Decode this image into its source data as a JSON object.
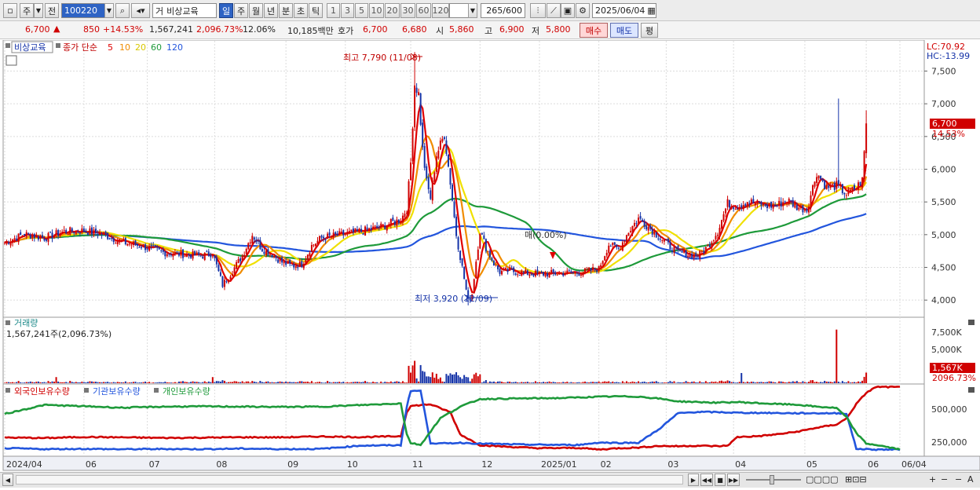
{
  "toolbar": {
    "item_tab": "주",
    "prev_label": "전",
    "code": "100220",
    "name": "비상교육",
    "periods": [
      "일",
      "주",
      "월",
      "년",
      "분",
      "초",
      "틱"
    ],
    "active_period": "일",
    "intervals": [
      "1",
      "3",
      "5",
      "10",
      "20",
      "30",
      "60",
      "120"
    ],
    "count": "265",
    "count_total": "/600",
    "date": "2025/06/04"
  },
  "quote": {
    "price": "6,700",
    "change": "850",
    "change_pct": "+14.53%",
    "volume": "1,567,241",
    "volume_ratio": "2,096.73%",
    "turnover": "12.06%",
    "amount": "10,185백만",
    "bid_label": "호가",
    "bid1": "6,700",
    "bid2": "6,680",
    "open_label": "시",
    "open": "5,860",
    "high_label": "고",
    "high": "6,900",
    "low_label": "저",
    "low": "5,800",
    "buy": "매수",
    "sell": "매도",
    "eval": "평"
  },
  "colors": {
    "up": "#d00000",
    "down": "#1533a8",
    "ma5": "#e00000",
    "ma10": "#f08c00",
    "ma20": "#f0e000",
    "ma60": "#1e9a3a",
    "ma120": "#2255dd"
  },
  "price_panel": {
    "item_name": "비상교육",
    "ma_title": "종가 단순",
    "ma_periods": [
      "5",
      "10",
      "20",
      "60",
      "120"
    ],
    "lc": "LC:70.92",
    "hc": "HC:-13.99",
    "annot_high": "최고 7,790 (11/08)",
    "annot_low": "최저 3,920 (12/09)",
    "annot_mid": "매(0.00%)",
    "last_price": "6,700",
    "last_pct": "14.53%"
  },
  "volume_panel": {
    "title": "거래량",
    "value": "1,567,241주(2,096.73%)",
    "last": "1,567K",
    "last_pct": "2096.73%"
  },
  "holding_panel": {
    "foreign": "외국인보유수량",
    "inst": "기관보유수량",
    "indiv": "개인보유수량"
  },
  "x_axis_labels": [
    {
      "t": "2024/04",
      "i": 0
    },
    {
      "t": "06",
      "i": 40
    },
    {
      "t": "07",
      "i": 72
    },
    {
      "t": "08",
      "i": 106
    },
    {
      "t": "09",
      "i": 142
    },
    {
      "t": "10",
      "i": 172
    },
    {
      "t": "11",
      "i": 205
    },
    {
      "t": "12",
      "i": 240
    },
    {
      "t": "2025/01",
      "i": 270
    },
    {
      "t": "02",
      "i": 300
    },
    {
      "t": "03",
      "i": 334
    },
    {
      "t": "04",
      "i": 368
    },
    {
      "t": "05",
      "i": 404
    },
    {
      "t": "06",
      "i": 435
    },
    {
      "t": "06/04",
      "i": 452
    }
  ],
  "chart_data": [
    {
      "type": "candlestick",
      "title": "비상교육",
      "y_ticks": [
        "7,500",
        "7,000",
        "6,500",
        "6,000",
        "5,500",
        "5,000",
        "4,500",
        "4,000"
      ],
      "ylim": [
        3750,
        7950
      ],
      "anchors_close": [
        [
          0,
          4880
        ],
        [
          10,
          5010
        ],
        [
          20,
          4950
        ],
        [
          30,
          5050
        ],
        [
          40,
          5060
        ],
        [
          50,
          5000
        ],
        [
          60,
          4880
        ],
        [
          70,
          4820
        ],
        [
          80,
          4730
        ],
        [
          90,
          4700
        ],
        [
          100,
          4680
        ],
        [
          105,
          4720
        ],
        [
          110,
          4230
        ],
        [
          115,
          4450
        ],
        [
          120,
          4680
        ],
        [
          125,
          5000
        ],
        [
          130,
          4780
        ],
        [
          135,
          4700
        ],
        [
          140,
          4580
        ],
        [
          145,
          4520
        ],
        [
          150,
          4550
        ],
        [
          155,
          4830
        ],
        [
          160,
          4950
        ],
        [
          170,
          5000
        ],
        [
          180,
          5050
        ],
        [
          190,
          5120
        ],
        [
          200,
          5230
        ],
        [
          203,
          5400
        ],
        [
          205,
          6100
        ],
        [
          207,
          7300
        ],
        [
          209,
          7150
        ],
        [
          211,
          6300
        ],
        [
          213,
          5800
        ],
        [
          215,
          5560
        ],
        [
          218,
          6220
        ],
        [
          222,
          6530
        ],
        [
          225,
          5800
        ],
        [
          228,
          5000
        ],
        [
          232,
          4330
        ],
        [
          234,
          3980
        ],
        [
          236,
          4100
        ],
        [
          238,
          4600
        ],
        [
          240,
          5060
        ],
        [
          243,
          4800
        ],
        [
          247,
          4560
        ],
        [
          250,
          4430
        ],
        [
          255,
          4450
        ],
        [
          260,
          4420
        ],
        [
          270,
          4400
        ],
        [
          280,
          4410
        ],
        [
          290,
          4420
        ],
        [
          300,
          4480
        ],
        [
          305,
          4850
        ],
        [
          310,
          4780
        ],
        [
          315,
          5050
        ],
        [
          320,
          5250
        ],
        [
          325,
          5120
        ],
        [
          330,
          4980
        ],
        [
          335,
          4840
        ],
        [
          340,
          4730
        ],
        [
          345,
          4700
        ],
        [
          350,
          4680
        ],
        [
          355,
          4820
        ],
        [
          360,
          5050
        ],
        [
          365,
          5480
        ],
        [
          370,
          5430
        ],
        [
          375,
          5510
        ],
        [
          380,
          5470
        ],
        [
          385,
          5440
        ],
        [
          390,
          5450
        ],
        [
          395,
          5530
        ],
        [
          400,
          5430
        ],
        [
          405,
          5380
        ],
        [
          410,
          5950
        ],
        [
          415,
          5720
        ],
        [
          420,
          5750
        ],
        [
          425,
          5620
        ],
        [
          430,
          5720
        ],
        [
          433,
          5830
        ],
        [
          435,
          6700
        ]
      ],
      "x_label_count": 436
    },
    {
      "type": "bar",
      "title": "거래량",
      "y_ticks": [
        "7,500K",
        "5,000K",
        "2,500K"
      ],
      "ylim": [
        0,
        9600
      ]
    },
    {
      "type": "line",
      "title": "보유수량",
      "y_ticks": [
        "500,000",
        "250,000"
      ],
      "ylim": [
        150000,
        680000
      ],
      "series": [
        {
          "name": "외국인보유수량",
          "anchors": [
            [
              0,
              286000
            ],
            [
              20,
              282000
            ],
            [
              40,
              290000
            ],
            [
              60,
              287000
            ],
            [
              80,
              283000
            ],
            [
              100,
              285000
            ],
            [
              120,
              288000
            ],
            [
              140,
              287000
            ],
            [
              160,
              294000
            ],
            [
              180,
              289000
            ],
            [
              200,
              296000
            ],
            [
              203,
              480000
            ],
            [
              205,
              525000
            ],
            [
              215,
              538000
            ],
            [
              225,
              478000
            ],
            [
              230,
              310000
            ],
            [
              235,
              268000
            ],
            [
              240,
              228000
            ],
            [
              255,
              215000
            ],
            [
              270,
              205000
            ],
            [
              290,
              207000
            ],
            [
              300,
              195000
            ],
            [
              310,
              205000
            ],
            [
              320,
              210000
            ],
            [
              330,
              222000
            ],
            [
              340,
              220000
            ],
            [
              350,
              224000
            ],
            [
              360,
              220000
            ],
            [
              365,
              225000
            ],
            [
              370,
              290000
            ],
            [
              380,
              296000
            ],
            [
              390,
              310000
            ],
            [
              400,
              330000
            ],
            [
              410,
              360000
            ],
            [
              420,
              385000
            ],
            [
              425,
              430000
            ],
            [
              430,
              540000
            ],
            [
              435,
              625000
            ],
            [
              440,
              670000
            ],
            [
              452,
              668000
            ]
          ]
        },
        {
          "name": "기관보유수량",
          "anchors": [
            [
              0,
              205000
            ],
            [
              20,
              198000
            ],
            [
              40,
              200000
            ],
            [
              60,
              197000
            ],
            [
              80,
              199000
            ],
            [
              100,
              198000
            ],
            [
              120,
              202000
            ],
            [
              140,
              198000
            ],
            [
              160,
              200000
            ],
            [
              180,
              225000
            ],
            [
              200,
              227000
            ],
            [
              203,
              520000
            ],
            [
              205,
              640000
            ],
            [
              210,
              640000
            ],
            [
              215,
              245000
            ],
            [
              220,
              240000
            ],
            [
              230,
              246000
            ],
            [
              240,
              240000
            ],
            [
              260,
              233000
            ],
            [
              280,
              230000
            ],
            [
              290,
              230000
            ],
            [
              300,
              248000
            ],
            [
              310,
              245000
            ],
            [
              320,
              247000
            ],
            [
              330,
              345000
            ],
            [
              340,
              470000
            ],
            [
              350,
              480000
            ],
            [
              360,
              478000
            ],
            [
              370,
              474000
            ],
            [
              380,
              473000
            ],
            [
              400,
              470000
            ],
            [
              410,
              470000
            ],
            [
              420,
              470000
            ],
            [
              425,
              468000
            ],
            [
              430,
              200000
            ],
            [
              440,
              195000
            ],
            [
              452,
              195000
            ]
          ]
        },
        {
          "name": "개인보유수량",
          "anchors": [
            [
              0,
              465000
            ],
            [
              20,
              533000
            ],
            [
              40,
              523000
            ],
            [
              60,
              512000
            ],
            [
              80,
              520000
            ],
            [
              100,
              522000
            ],
            [
              120,
              520000
            ],
            [
              140,
              518000
            ],
            [
              160,
              520000
            ],
            [
              180,
              532000
            ],
            [
              200,
              545000
            ],
            [
              203,
              310000
            ],
            [
              205,
              245000
            ],
            [
              210,
              230000
            ],
            [
              220,
              433000
            ],
            [
              230,
              520000
            ],
            [
              240,
              578000
            ],
            [
              260,
              582000
            ],
            [
              280,
              585000
            ],
            [
              300,
              595000
            ],
            [
              310,
              598000
            ],
            [
              320,
              596000
            ],
            [
              330,
              582000
            ],
            [
              340,
              560000
            ],
            [
              350,
              555000
            ],
            [
              360,
              550000
            ],
            [
              370,
              555000
            ],
            [
              380,
              547000
            ],
            [
              390,
              540000
            ],
            [
              400,
              535000
            ],
            [
              410,
              520000
            ],
            [
              420,
              510000
            ],
            [
              425,
              440000
            ],
            [
              430,
              320000
            ],
            [
              435,
              240000
            ],
            [
              440,
              230000
            ],
            [
              452,
              195000
            ]
          ]
        }
      ]
    }
  ]
}
